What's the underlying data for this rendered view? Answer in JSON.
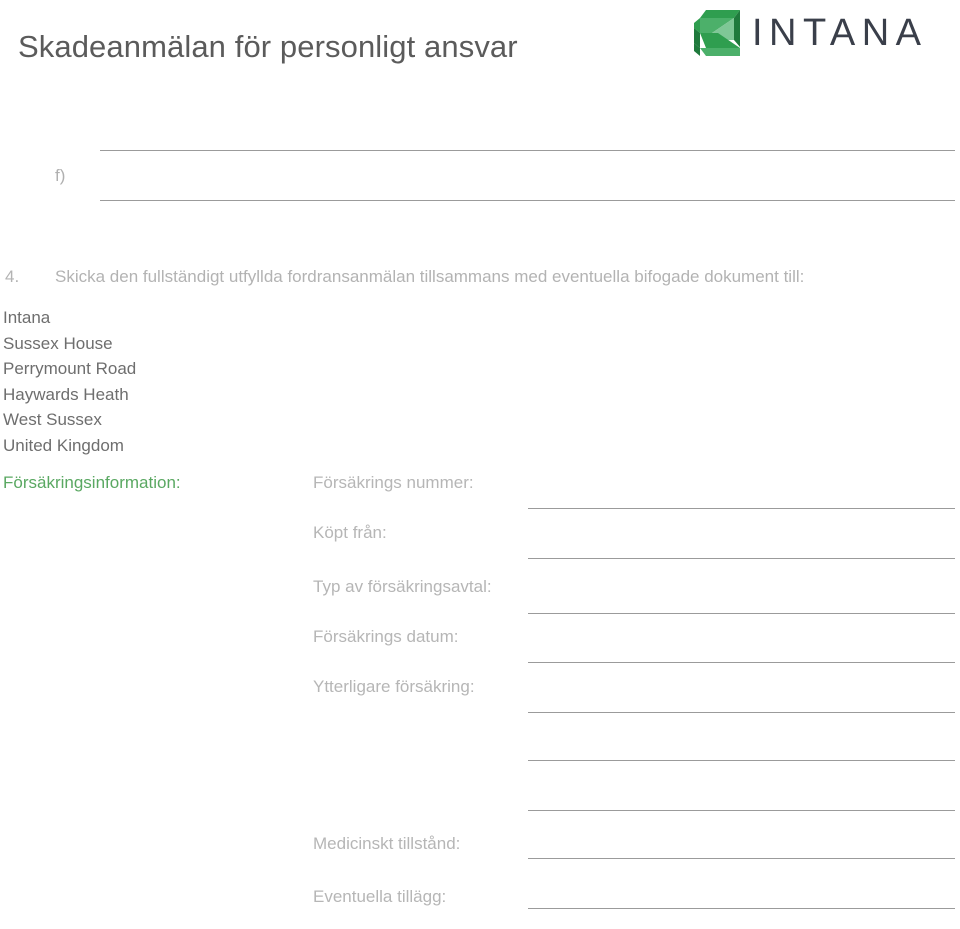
{
  "document": {
    "title": "Skadeanmälan för personligt ansvar"
  },
  "brand": {
    "wordmark": "INTANA",
    "mark_icon": "intana-chevron-logo",
    "green": "#2f9e4f",
    "green_light": "#7fc796",
    "green_dark": "#1f7a3c",
    "wordmark_color": "#3a3f4a"
  },
  "items": {
    "f_marker": "f)",
    "four_marker": "4.",
    "four_text": "Skicka den fullständigt utfyllda fordransanmälan tillsammans med eventuella bifogade dokument till:"
  },
  "address": {
    "lines": [
      "Intana",
      "Sussex House",
      "Perrymount Road",
      "Haywards Heath",
      "West Sussex",
      "United Kingdom"
    ]
  },
  "section": {
    "heading": "Försäkringsinformation:",
    "heading_color": "#5aa862"
  },
  "fields": [
    {
      "label": "Försäkrings nummer:",
      "value": ""
    },
    {
      "label": "Köpt från:",
      "value": ""
    },
    {
      "label": "Typ av försäkringsavtal:",
      "value": ""
    },
    {
      "label": "Försäkrings datum:",
      "value": ""
    },
    {
      "label": "Ytterligare försäkring:",
      "value": ""
    },
    {
      "label": "Medicinskt tillstånd:",
      "value": ""
    },
    {
      "label": "Eventuella tillägg:",
      "value": ""
    }
  ],
  "colors": {
    "rule": "#9b9b9b",
    "title_text": "#5b5b5b",
    "body_text": "#6e6e6e",
    "muted_text": "#b3b3b3"
  }
}
